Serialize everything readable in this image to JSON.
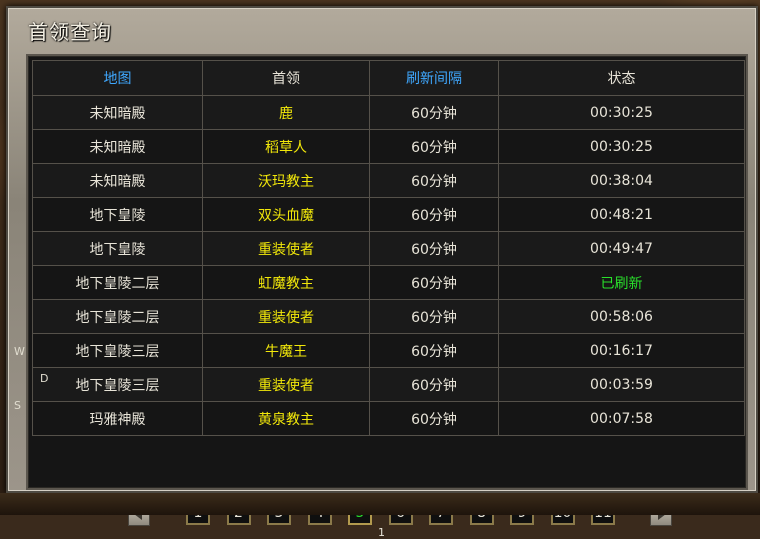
{
  "title": "首领查询",
  "columns": [
    "地图",
    "首领",
    "刷新间隔",
    "状态"
  ],
  "rows": [
    {
      "map": "未知暗殿",
      "boss": "鹿",
      "interval": "60分钟",
      "status": "00:30:25"
    },
    {
      "map": "未知暗殿",
      "boss": "稻草人",
      "interval": "60分钟",
      "status": "00:30:25"
    },
    {
      "map": "未知暗殿",
      "boss": "沃玛教主",
      "interval": "60分钟",
      "status": "00:38:04"
    },
    {
      "map": "地下皇陵",
      "boss": "双头血魔",
      "interval": "60分钟",
      "status": "00:48:21"
    },
    {
      "map": "地下皇陵",
      "boss": "重装使者",
      "interval": "60分钟",
      "status": "00:49:47"
    },
    {
      "map": "地下皇陵二层",
      "boss": "虹魔教主",
      "interval": "60分钟",
      "status": "已刷新"
    },
    {
      "map": "地下皇陵二层",
      "boss": "重装使者",
      "interval": "60分钟",
      "status": "00:58:06"
    },
    {
      "map": "地下皇陵三层",
      "boss": "牛魔王",
      "interval": "60分钟",
      "status": "00:16:17"
    },
    {
      "map": "地下皇陵三层",
      "boss": "重装使者",
      "interval": "60分钟",
      "status": "00:03:59"
    },
    {
      "map": "玛雅神殿",
      "boss": "黄泉教主",
      "interval": "60分钟",
      "status": "00:07:58"
    }
  ],
  "pages": [
    "1",
    "2",
    "3",
    "4",
    "5",
    "6",
    "7",
    "8",
    "9",
    "10",
    "11"
  ],
  "current_page": "5",
  "current_page_sub": "1",
  "side_labels": [
    "W",
    "D",
    "S"
  ],
  "colors": {
    "header_blue": "#3fa8ff",
    "boss_yellow": "#f2e80a",
    "refreshed_green": "#29e12b"
  }
}
